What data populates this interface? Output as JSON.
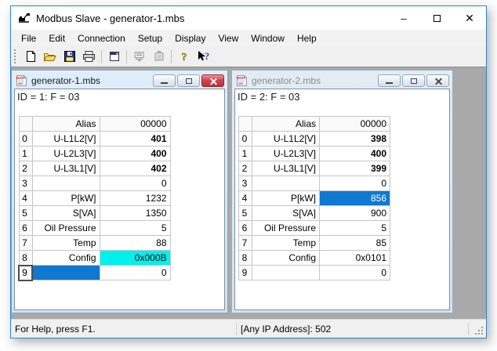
{
  "window": {
    "title": "Modbus Slave - generator-1.mbs",
    "controls": {
      "minimize": "–",
      "maximize": "",
      "close": "✕"
    }
  },
  "menu": {
    "items": [
      "File",
      "Edit",
      "Connection",
      "Setup",
      "Display",
      "View",
      "Window",
      "Help"
    ]
  },
  "toolbar": {
    "buttons": [
      "new",
      "open",
      "save",
      "print",
      "display-setup",
      "connection-setup",
      "communication",
      "help",
      "context-help"
    ]
  },
  "documents": [
    {
      "title": "generator-1.mbs",
      "active": true,
      "status_line": "ID = 1: F = 03",
      "grid": {
        "columns": [
          "",
          "Alias",
          "00000"
        ],
        "rows": [
          {
            "n": "0",
            "alias": "U-L1L2[V]",
            "value": "401",
            "bold": true
          },
          {
            "n": "1",
            "alias": "U-L2L3[V]",
            "value": "400",
            "bold": true
          },
          {
            "n": "2",
            "alias": "U-L3L1[V]",
            "value": "402",
            "bold": true
          },
          {
            "n": "3",
            "alias": "",
            "value": "0"
          },
          {
            "n": "4",
            "alias": "P[kW]",
            "value": "1232"
          },
          {
            "n": "5",
            "alias": "S[VA]",
            "value": "1350"
          },
          {
            "n": "6",
            "alias": "Oil Pressure",
            "value": "5"
          },
          {
            "n": "7",
            "alias": "Temp",
            "value": "88"
          },
          {
            "n": "8",
            "alias": "Config",
            "value": "0x000B",
            "value_style": "cyan"
          },
          {
            "n": "9",
            "alias": "",
            "value": "0",
            "alias_style": "selected",
            "row_focus": true
          }
        ]
      }
    },
    {
      "title": "generator-2.mbs",
      "active": false,
      "status_line": "ID = 2: F = 03",
      "grid": {
        "columns": [
          "",
          "Alias",
          "00000"
        ],
        "rows": [
          {
            "n": "0",
            "alias": "U-L1L2[V]",
            "value": "398",
            "bold": true
          },
          {
            "n": "1",
            "alias": "U-L2L3[V]",
            "value": "400",
            "bold": true
          },
          {
            "n": "2",
            "alias": "U-L3L1[V]",
            "value": "399",
            "bold": true
          },
          {
            "n": "3",
            "alias": "",
            "value": "0"
          },
          {
            "n": "4",
            "alias": "P[kW]",
            "value": "856",
            "value_style": "selected"
          },
          {
            "n": "5",
            "alias": "S[VA]",
            "value": "900"
          },
          {
            "n": "6",
            "alias": "Oil Pressure",
            "value": "5"
          },
          {
            "n": "7",
            "alias": "Temp",
            "value": "85"
          },
          {
            "n": "8",
            "alias": "Config",
            "value": "0x0101"
          },
          {
            "n": "9",
            "alias": "",
            "value": "0"
          }
        ]
      }
    }
  ],
  "status_bar": {
    "left": "For Help, press F1.",
    "connection": "[Any IP Address]: 502"
  },
  "colors": {
    "accent_blue": "#2a86d4",
    "selection_blue": "#0f78d0",
    "highlight_cyan": "#00f0ee",
    "close_red": "#d4444f",
    "mdi_background": "#a9a9a9"
  }
}
